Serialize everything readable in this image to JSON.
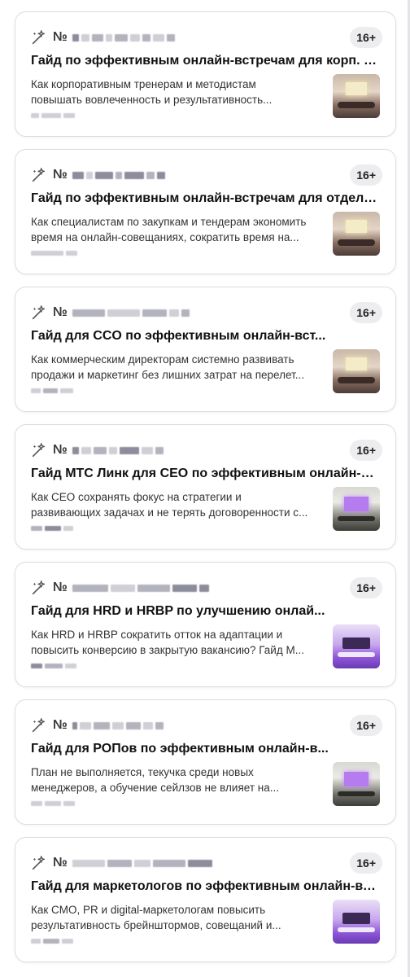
{
  "feed": {
    "cards": [
      {
        "num_sign": "№",
        "age": "16+",
        "title": "Гайд по эффективным онлайн-встречам для корп. тр...",
        "desc_line1": "Как корпоративным тренерам и методистам",
        "desc_line2": "повышать вовлеченность и результативность...",
        "thumb": "thumb-a"
      },
      {
        "num_sign": "№",
        "age": "16+",
        "title": "Гайд по эффективным онлайн-встречам для отделов ...",
        "desc_line1": "Как специалистам по закупкам и тендерам экономить",
        "desc_line2": "время на онлайн-совещаниях, сократить время на...",
        "thumb": "thumb-a"
      },
      {
        "num_sign": "№",
        "age": "16+",
        "title": "Гайд                  для CCO по эффективным онлайн-вст...",
        "desc_line1": "Как коммерческим директорам системно развивать",
        "desc_line2": "продажи и маркетинг без лишних затрат на перелет...",
        "thumb": "thumb-a"
      },
      {
        "num_sign": "№",
        "age": "16+",
        "title": "Гайд МТС Линк для CEO по эффективным онлайн-вст...",
        "desc_line1": "Как CEO сохранять фокус на стратегии и",
        "desc_line2": "развивающих задачах и не терять договоренности с...",
        "thumb": "thumb-b"
      },
      {
        "num_sign": "№",
        "age": "16+",
        "title": "Гайд                  для HRD и HRBP по улучшению онлай...",
        "desc_line1": "Как HRD и HRBP сократить отток на адаптации и",
        "desc_line2": "повысить конверсию в закрытую вакансию? Гайд М...",
        "thumb": "thumb-c"
      },
      {
        "num_sign": "№",
        "age": "16+",
        "title": "Гайд                  для РОПов по эффективным онлайн-в...",
        "desc_line1": "План не выполняется, текучка среди новых",
        "desc_line2": "менеджеров, а обучение сейлзов не влияет на...",
        "thumb": "thumb-b"
      },
      {
        "num_sign": "№",
        "age": "16+",
        "title": "Гайд для маркетологов по эффективным онлайн-вст...",
        "desc_line1": "Как CMO, PR и digital-маркетологам повысить",
        "desc_line2": "результативность брейнштормов, совещаний и...",
        "thumb": "thumb-c"
      }
    ]
  }
}
